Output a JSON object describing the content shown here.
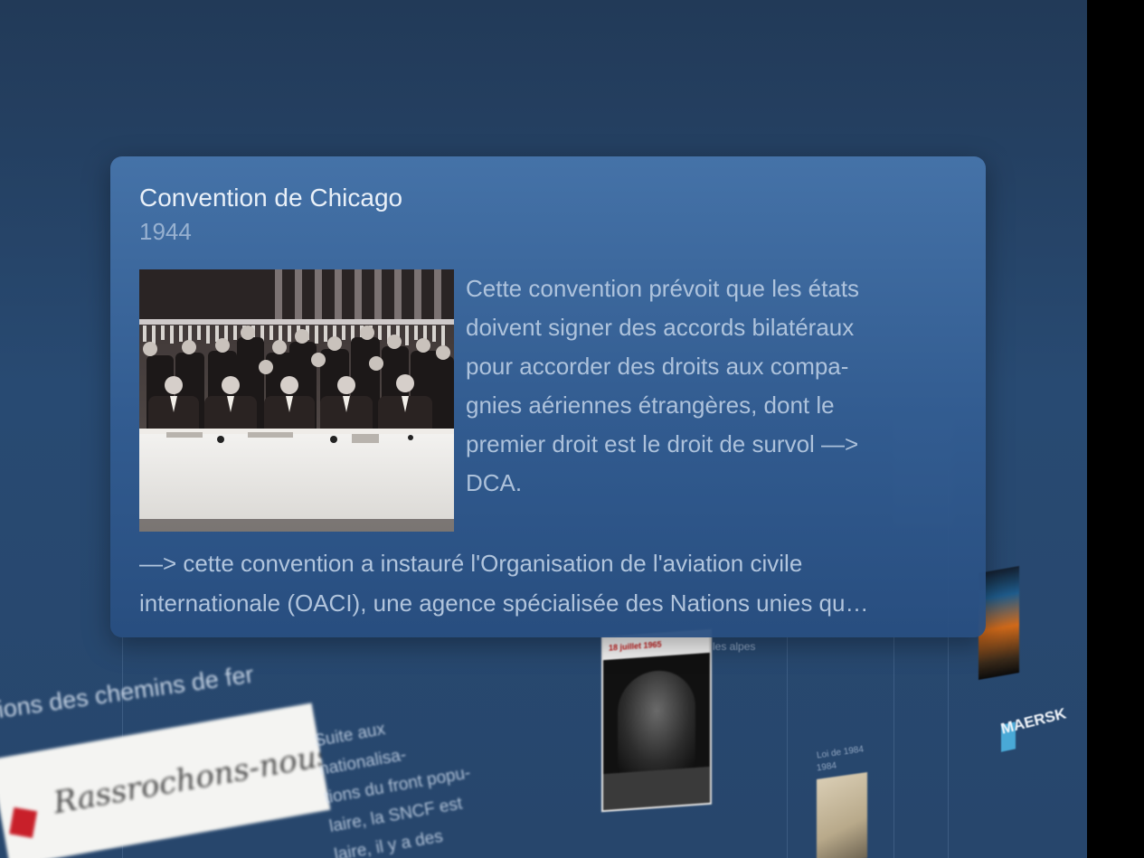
{
  "card": {
    "title": "Convention de Chicago",
    "year": "1944",
    "description_lines": [
      "Cette convention prévoit que les états",
      "doivent signer des accords bilatéraux",
      "pour accorder des droits aux compa-",
      "gnies aériennes étrangères, dont le",
      "premier droit est le droit de survol —>",
      "DCA."
    ],
    "note_lines": [
      "—> cette convention a instauré l'Organisation de l'aviation civile",
      "internationale (OACI), une agence spécialisée des Nations unies qu…"
    ],
    "photo_icon": "signing-ceremony-photo"
  },
  "background": {
    "section_title": "ions des chemins de fer",
    "card_script": "Rassrochons-nous",
    "paragraph_lines": [
      "Suite aux nationalisa-",
      "tions du front popu-",
      "laire, la SNCF est",
      "laire, il y a des indemnités."
    ],
    "tunnel_banner": "18 juillet 1965",
    "tunnel_caption": "les alpes",
    "law_title": "Loi de 1984",
    "law_year": "1984",
    "maersk_label": "MAERSK",
    "colors": {
      "background": "#27466c",
      "card": "#3f6ba0",
      "text": "#e9f0f8"
    }
  }
}
